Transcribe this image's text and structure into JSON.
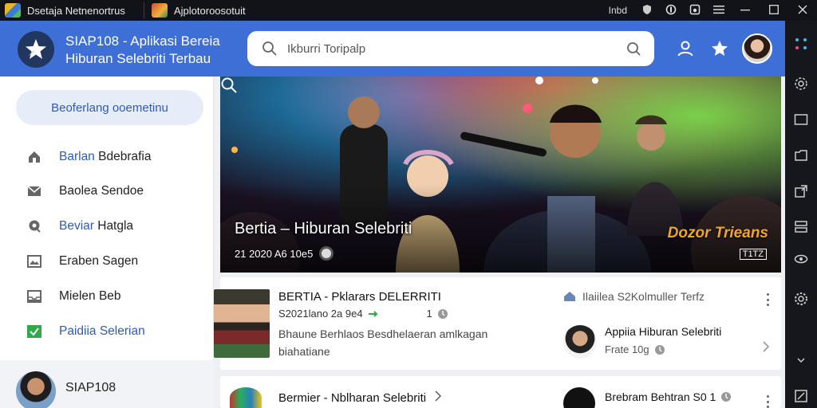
{
  "window": {
    "tabs": [
      {
        "label": "Dsetaja  Netnenortrus",
        "icon": "app-icon"
      },
      {
        "label": "Ajplotoroosotuit",
        "icon": "app-icon"
      }
    ],
    "controls": {
      "label": "Inbd",
      "icons": [
        "shield-icon",
        "vpn-icon",
        "save-icon",
        "menu-icon",
        "minimize-icon",
        "maximize-icon",
        "close-icon"
      ]
    }
  },
  "header": {
    "title_line1": "SIAP108 - Aplikasi Bereia",
    "title_line2": "Hiburan Selebriti Terbau",
    "search_placeholder": "Ikburri Toripalp",
    "accent": "#3d6fd6"
  },
  "sidebar": {
    "search_label": "Beoferlang ooemetinu",
    "items": [
      {
        "prefix": "Barlan",
        "rest": " Bdebrafia",
        "icon": "home-icon",
        "highlight_prefix": true
      },
      {
        "prefix": "Baolea Sendoe",
        "rest": "",
        "icon": "mail-icon",
        "highlight_prefix": false
      },
      {
        "prefix": "Beviar",
        "rest": " Hatgla",
        "icon": "location-icon",
        "highlight_prefix": true
      },
      {
        "prefix": "Eraben Sagen",
        "rest": "",
        "icon": "image-icon",
        "highlight_prefix": false
      },
      {
        "prefix": "Mielen Beb",
        "rest": "",
        "icon": "inbox-icon",
        "highlight_prefix": false
      },
      {
        "prefix": "Paidiia Selerian",
        "rest": "",
        "icon": "check-icon",
        "highlight_prefix": true
      }
    ],
    "user_name": "SIAP108"
  },
  "hero": {
    "title": "Bertia  – Hiburan Selebriti",
    "meta": "21 2020 A6 10e5",
    "brand": "Dozor Trieans",
    "badge": "T1TZ"
  },
  "cards": [
    {
      "title": "BERTIA - Pklarars DELERRITI",
      "meta": "S2021lano 2a 9e4",
      "meta_count": "1",
      "body_line1": "Bhaune Berhlaos Besdhelaeran amlkagan",
      "body_line2": "biahatiane",
      "right_top": "Ilaiilea S2Kolmuller Terfz",
      "right_name": "Appiia Hiburan Selebriti",
      "right_meta": "Frate 10g"
    },
    {
      "title": "Bermier - Nblharan Selebriti",
      "right_name": "Brebram Behtran S0 1"
    }
  ]
}
